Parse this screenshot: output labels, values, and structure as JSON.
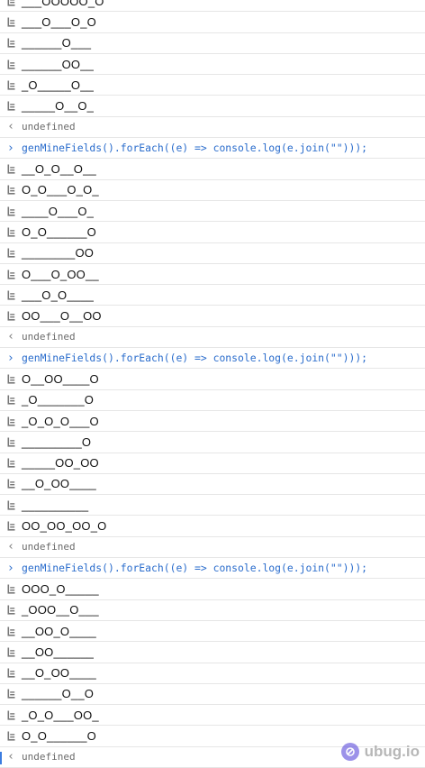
{
  "console": {
    "undefined_text": "undefined",
    "command_text": "genMineFields().forEach((e) => console.log(e.join(\"\")));",
    "blocks": [
      {
        "lines": [
          "___OOOOO_O",
          "___O___O_O",
          "______O___",
          "______OO__",
          "_O_____O__",
          "_____O__O_"
        ]
      },
      {
        "lines": [
          "__O_O__O__",
          "O_O___O_O_",
          "____O___O_",
          "O_O______O",
          "________OO",
          "O___O_OO__",
          "___O_O____",
          "OO___O__OO"
        ]
      },
      {
        "lines": [
          "O__OO____O",
          "_O_______O",
          "_O_O_O___O",
          "_________O",
          "_____OO_OO",
          "__O_OO____",
          "__________",
          "OO_OO_OO_O"
        ]
      },
      {
        "lines": [
          "OOO_O_____",
          "_OOO__O___",
          "__OO_O____",
          "__OO______",
          "__O_OO____",
          "______O__O",
          "_O_O___OO_",
          "O_O______O"
        ]
      }
    ]
  },
  "watermark": {
    "text": "ubug.io"
  },
  "colors": {
    "command": "#2a6ccc",
    "result": "#6a6a6a",
    "separator": "#e6e6e6"
  }
}
